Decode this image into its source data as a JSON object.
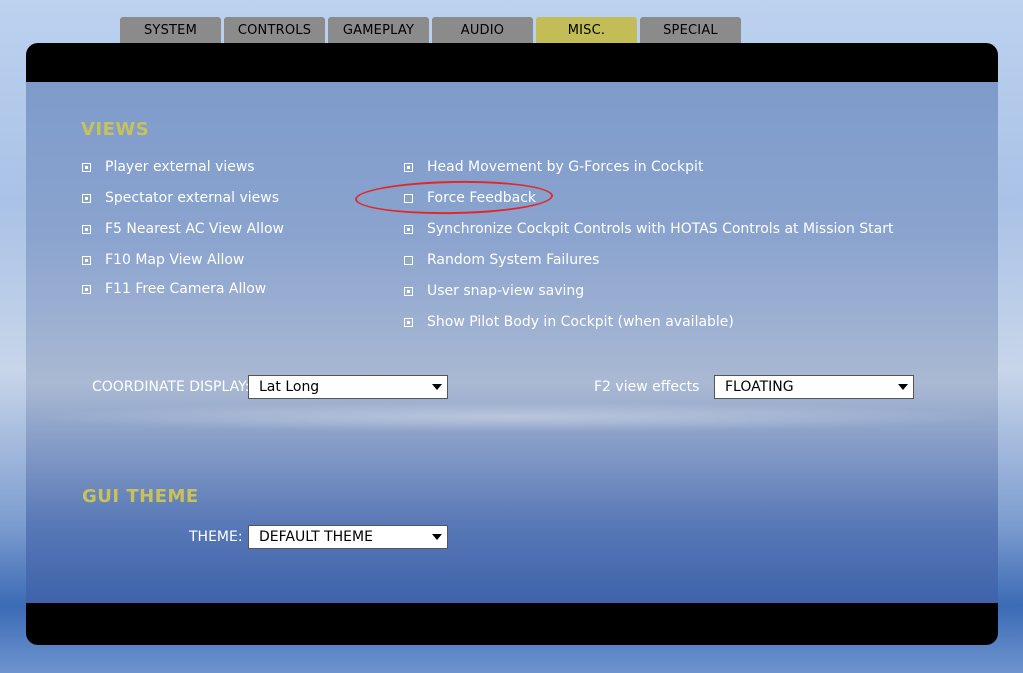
{
  "tabs": [
    {
      "label": "SYSTEM",
      "active": false
    },
    {
      "label": "CONTROLS",
      "active": false
    },
    {
      "label": "GAMEPLAY",
      "active": false
    },
    {
      "label": "AUDIO",
      "active": false
    },
    {
      "label": "MISC.",
      "active": true
    },
    {
      "label": "SPECIAL",
      "active": false
    }
  ],
  "views": {
    "title": "VIEWS",
    "left_options": [
      {
        "label": "Player external views",
        "checked": true
      },
      {
        "label": "Spectator external views",
        "checked": true
      },
      {
        "label": "F5 Nearest AC View Allow",
        "checked": true
      },
      {
        "label": "F10 Map View Allow",
        "checked": true
      },
      {
        "label": "F11 Free Camera Allow",
        "checked": true
      }
    ],
    "right_options": [
      {
        "label": "Head Movement by G-Forces in Cockpit",
        "checked": true
      },
      {
        "label": "Force Feedback",
        "checked": false
      },
      {
        "label": "Synchronize Cockpit Controls with HOTAS Controls at Mission Start",
        "checked": true
      },
      {
        "label": "Random System Failures",
        "checked": false
      },
      {
        "label": "User snap-view saving",
        "checked": true
      },
      {
        "label": "Show Pilot Body in Cockpit (when available)",
        "checked": true
      }
    ],
    "coordinate_display": {
      "label": "COORDINATE DISPLAY:",
      "value": "Lat Long"
    },
    "f2_view_effects": {
      "label": "F2 view effects",
      "value": "FLOATING"
    }
  },
  "gui_theme": {
    "title": "GUI THEME",
    "theme": {
      "label": "THEME:",
      "value": "DEFAULT THEME"
    }
  },
  "colors": {
    "accent": "#c9c25a",
    "active_tab": "#c3bd57",
    "inactive_tab": "#8b8b8b",
    "annotation": "#e0282b"
  }
}
